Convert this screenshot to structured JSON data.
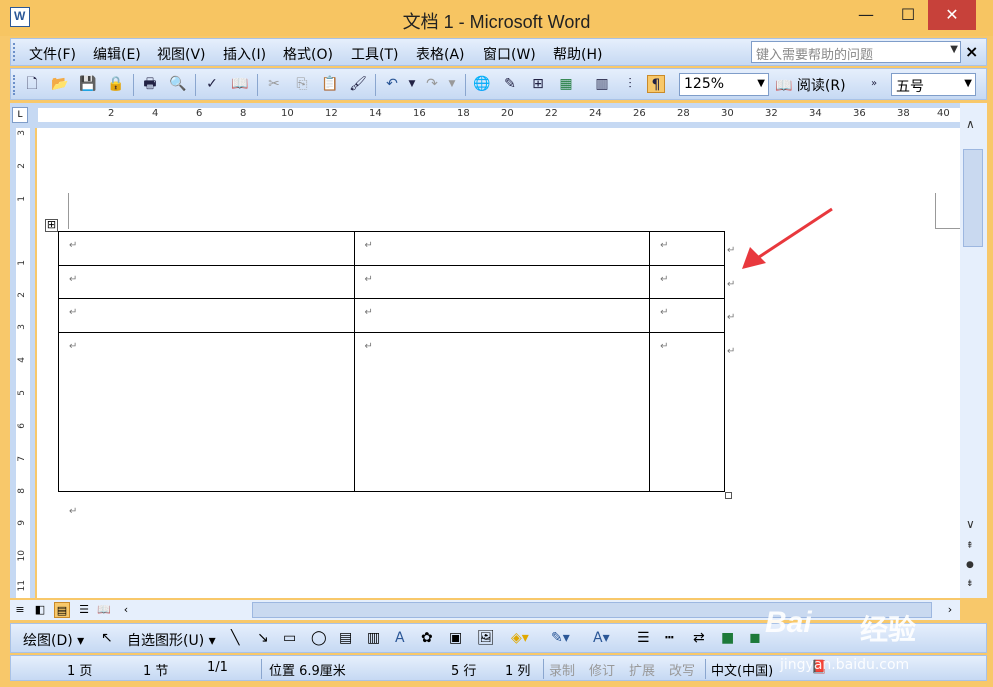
{
  "window": {
    "title": "文档 1 - Microsoft Word",
    "controls": {
      "minimize": "—",
      "maximize": "☐",
      "close": "✕"
    }
  },
  "menubar": {
    "items": [
      "文件(F)",
      "编辑(E)",
      "视图(V)",
      "插入(I)",
      "格式(O)",
      "工具(T)",
      "表格(A)",
      "窗口(W)",
      "帮助(H)"
    ],
    "help_placeholder": "键入需要帮助的问题",
    "close_label": "×"
  },
  "toolbar": {
    "icons": [
      "new-icon",
      "open-icon",
      "save-icon",
      "permission-icon",
      "print-icon",
      "print-preview-icon",
      "spelling-icon",
      "research-icon",
      "cut-icon",
      "copy-icon",
      "paste-icon",
      "format-painter-icon",
      "undo-icon",
      "redo-icon",
      "hyperlink-icon",
      "tables-borders-icon",
      "insert-table-icon",
      "insert-excel-icon",
      "columns-icon",
      "drawing-icon",
      "document-map-icon"
    ],
    "zoom": "125%",
    "read_label": "阅读(R)",
    "font_size": "五号"
  },
  "ruler": {
    "h_ticks": [
      "2",
      "4",
      "6",
      "8",
      "10",
      "12",
      "14",
      "16",
      "18",
      "20",
      "22",
      "24",
      "26",
      "28",
      "30",
      "32",
      "34",
      "36",
      "38",
      "40"
    ],
    "v_ticks": [
      "3",
      "2",
      "1",
      "1",
      "2",
      "3",
      "4",
      "5",
      "6",
      "7",
      "8",
      "9",
      "10",
      "11"
    ],
    "corner": "L"
  },
  "document": {
    "para_mark": "↵",
    "table": {
      "rows": [
        [
          "↵",
          "↵",
          "↵"
        ],
        [
          "↵",
          "↵",
          "↵"
        ],
        [
          "↵",
          "↵",
          "↵"
        ],
        [
          "↵",
          "↵",
          "↵"
        ]
      ],
      "row_end_marks": [
        "↵",
        "↵",
        "↵",
        "↵"
      ],
      "move_handle": "⊞"
    }
  },
  "drawing_toolbar": {
    "draw_label": "绘图(D)",
    "autoshapes_label": "自选图形(U)"
  },
  "statusbar": {
    "page": "1 页",
    "section": "1 节",
    "page_of": "1/1",
    "position": "位置 6.9厘米",
    "line": "5 行",
    "column": "1 列",
    "rec": "录制",
    "trk": "修订",
    "ext": "扩展",
    "ovr": "改写",
    "language": "中文(中国)"
  },
  "watermark": {
    "logo": "Bai",
    "text": "经验",
    "sub": "jingyan.baidu.com"
  },
  "colors": {
    "title_bg": "#f7c562",
    "accent_arrow": "#e8383d",
    "toolbar_bg": "#c6d9f3"
  }
}
